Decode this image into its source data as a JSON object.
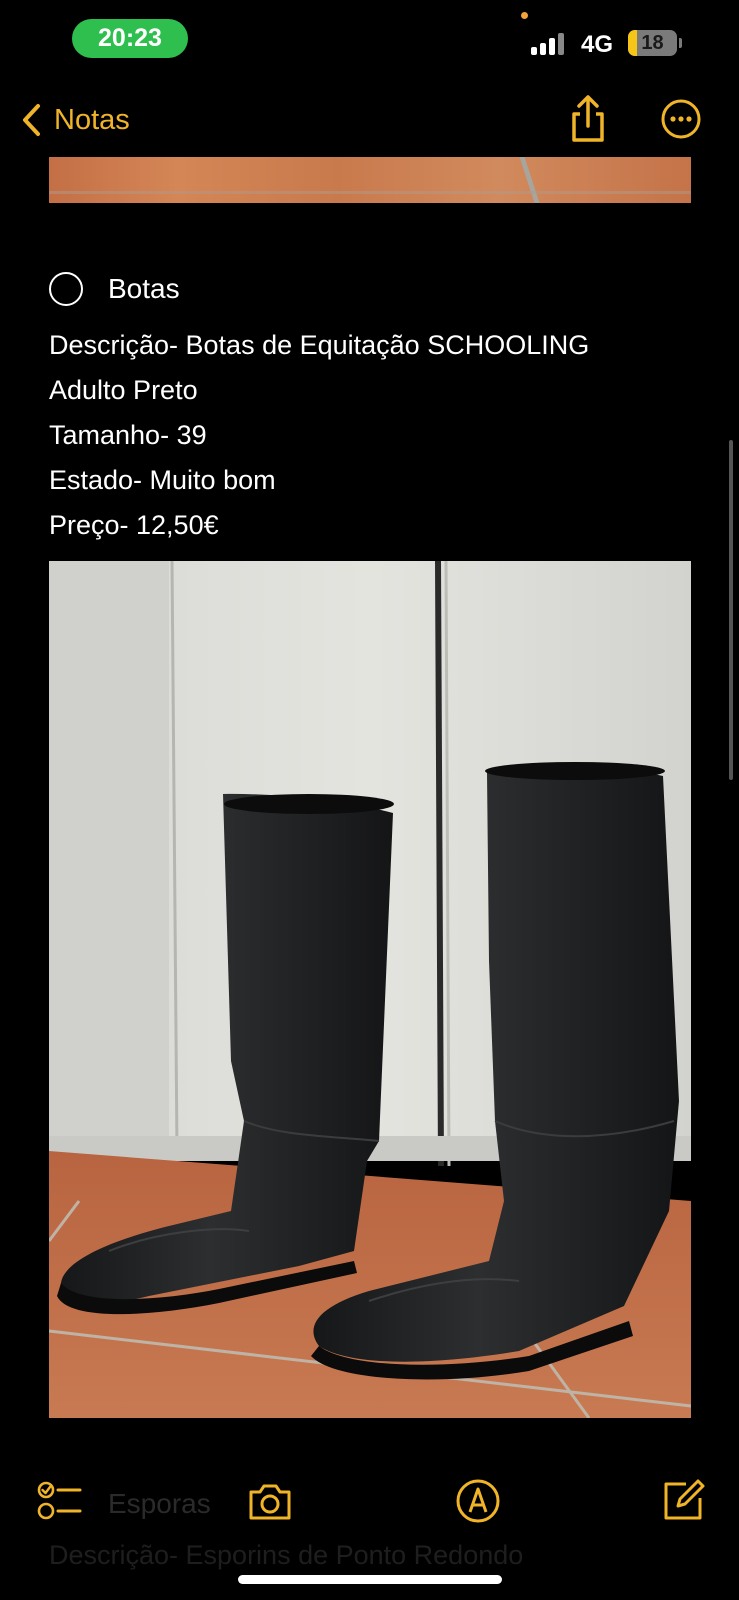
{
  "status_bar": {
    "time": "20:23",
    "network": "4G",
    "battery_level": "18",
    "battery_fraction": 0.18
  },
  "nav": {
    "back_label": "Notas",
    "accent_color": "#f0b429"
  },
  "note": {
    "checklist_item": "Botas",
    "lines": [
      "Descrição- Botas de Equitação SCHOOLING",
      "Adulto Preto",
      "Tamanho- 39",
      "Estado- Muito bom",
      "Preço- 12,50€"
    ],
    "next_checklist_item": "Esporas",
    "next_line": "Descrição- Esporins de Ponto Redondo"
  },
  "toolbar": {
    "icons": [
      "checklist-icon",
      "camera-icon",
      "markup-icon",
      "compose-icon"
    ]
  }
}
